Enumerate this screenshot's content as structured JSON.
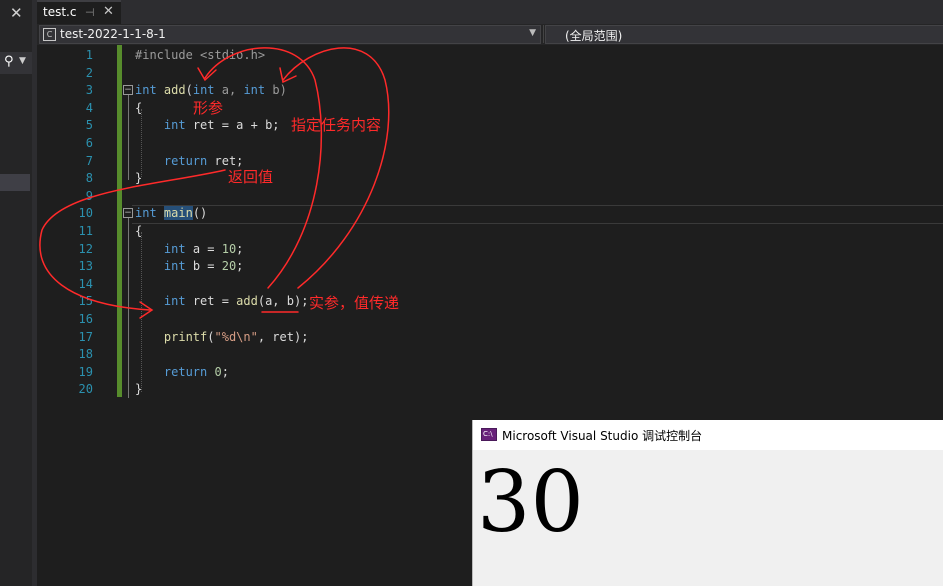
{
  "tabs": [
    {
      "label": "test.c",
      "pin_icon": "pin-icon",
      "close_icon": "close-icon"
    }
  ],
  "solution_panel": {
    "close_icon": "close-icon",
    "search_icon": "search-icon"
  },
  "nav_bar": {
    "project": "test-2022-1-1-8-1",
    "scope": "(全局范围)"
  },
  "editor": {
    "line_numbers": [
      "1",
      "2",
      "3",
      "4",
      "5",
      "6",
      "7",
      "8",
      "9",
      "10",
      "11",
      "12",
      "13",
      "14",
      "15",
      "16",
      "17",
      "18",
      "19",
      "20"
    ],
    "code": {
      "l1_include": "#include <stdio.h>",
      "l3_int": "int",
      "l3_add": "add",
      "l3_open": "(",
      "l3_int_a": "int",
      "l3_a": " a, ",
      "l3_int_b": "int",
      "l3_b": " b)",
      "l4": "{",
      "l5_int": "int",
      "l5_rest": " ret = a + b;",
      "l7_return": "return",
      "l7_rest": " ret;",
      "l8": "}",
      "l10_int": "int",
      "l10_main": "main",
      "l10_rest": "()",
      "l11": "{",
      "l12_int": "int",
      "l12_rest": " a = ",
      "l12_num": "10",
      "l12_end": ";",
      "l13_int": "int",
      "l13_rest": " b = ",
      "l13_num": "20",
      "l13_end": ";",
      "l15_int": "int",
      "l15_rest": " ret = ",
      "l15_add": "add",
      "l15_args": "(a, b);",
      "l17_printf": "printf",
      "l17_open": "(",
      "l17_str": "\"%d\\n\"",
      "l17_rest": ", ret);",
      "l19_return": "return",
      "l19_num": " 0",
      "l19_end": ";",
      "l20": "}"
    }
  },
  "annotations": {
    "formal_params": "形参",
    "task_content": "指定任务内容",
    "return_value": "返回值",
    "actual_params": "实参，值传递",
    "color": "#ff2a2a"
  },
  "console": {
    "title": "Microsoft Visual Studio 调试控制台",
    "icon": "console-app-icon",
    "output": "30"
  }
}
